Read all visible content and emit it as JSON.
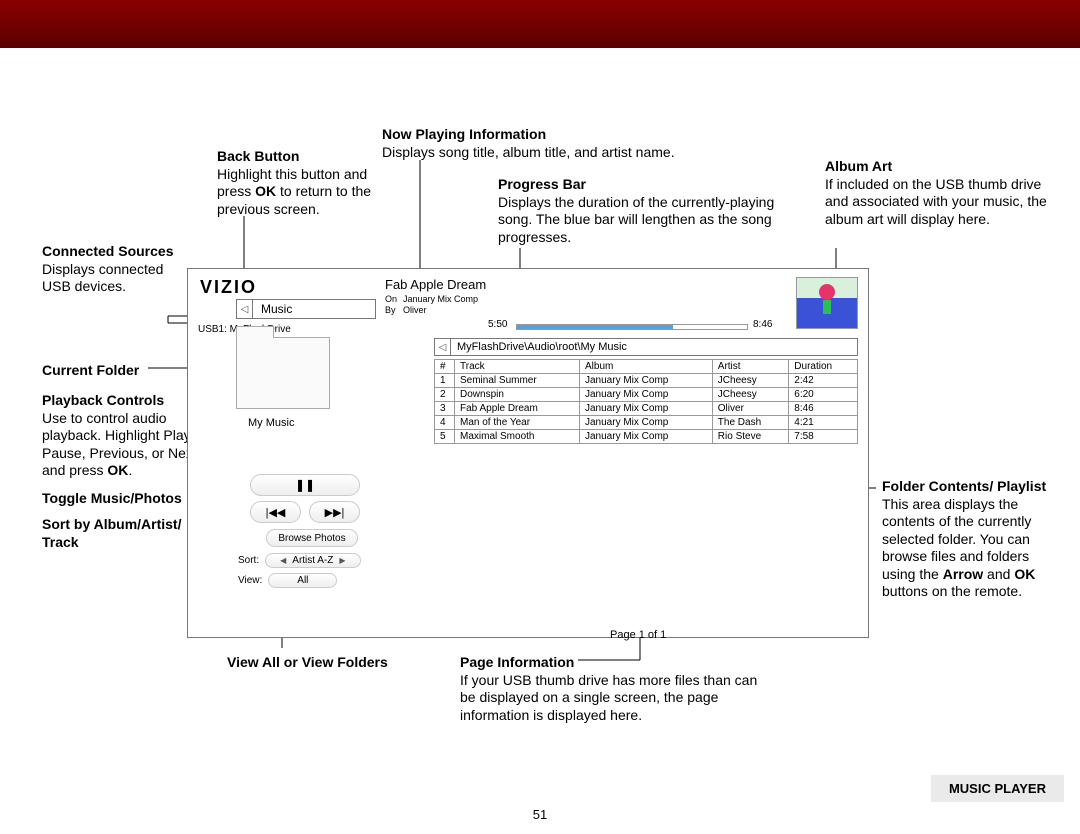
{
  "page_number": "51",
  "footer_label": "MUSIC PLAYER",
  "annotations": {
    "back_button": {
      "title": "Back Button",
      "body": "Highlight this button and press OK to return to the previous screen."
    },
    "now_playing": {
      "title": "Now Playing Information",
      "body": "Displays song title, album title, and artist name."
    },
    "progress_bar": {
      "title": "Progress Bar",
      "body": "Displays the duration of the currently-playing song. The blue bar will lengthen as the song progresses."
    },
    "album_art": {
      "title": "Album Art",
      "body": "If included on the USB thumb drive and associated with your music, the album art will display here."
    },
    "connected_sources": {
      "title": "Connected Sources",
      "body": "Displays connected USB devices."
    },
    "current_folder": {
      "title": "Current Folder"
    },
    "playback_controls": {
      "title": "Playback Controls",
      "body": "Use to control audio playback. Highlight Play/ Pause, Previous, or Next and press OK."
    },
    "toggle": {
      "title": "Toggle Music/Photos"
    },
    "sort": {
      "title": "Sort by Album/Artist/ Track"
    },
    "view": {
      "title": "View All or View Folders"
    },
    "page_info": {
      "title": "Page Information",
      "body": "If your USB thumb drive has more files than can be displayed on a single screen, the page information is displayed here."
    },
    "folder_contents": {
      "title": "Folder Contents/ Playlist",
      "body_pre": "This area displays the contents of the currently selected folder. You can browse files and folders using the ",
      "body_bold": "Arrow",
      "body_mid": " and ",
      "body_bold2": "OK",
      "body_post": " buttons on the remote."
    }
  },
  "player": {
    "logo": "VIZIO",
    "music_label": "Music",
    "usb_source": "USB1: MyFlashDrive",
    "folder_label": "My Music",
    "browse_photos": "Browse Photos",
    "sort_label": "Sort:",
    "sort_value": "Artist A-Z",
    "view_label": "View:",
    "view_value": "All",
    "now_playing": {
      "title": "Fab Apple Dream",
      "on_label": "On",
      "on_value": "January Mix Comp",
      "by_label": "By",
      "by_value": "Oliver"
    },
    "time_elapsed": "5:50",
    "time_total": "8:46",
    "path": "MyFlashDrive\\Audio\\root\\My Music",
    "page_info": "Page 1 of 1",
    "columns": {
      "num": "#",
      "track": "Track",
      "album": "Album",
      "artist": "Artist",
      "duration": "Duration"
    },
    "tracks": [
      {
        "num": "1",
        "track": "Seminal Summer",
        "album": "January Mix Comp",
        "artist": "JCheesy",
        "duration": "2:42"
      },
      {
        "num": "2",
        "track": "Downspin",
        "album": "January Mix Comp",
        "artist": "JCheesy",
        "duration": "6:20"
      },
      {
        "num": "3",
        "track": "Fab Apple Dream",
        "album": "January Mix Comp",
        "artist": "Oliver",
        "duration": "8:46"
      },
      {
        "num": "4",
        "track": "Man of the Year",
        "album": "January Mix Comp",
        "artist": "The Dash",
        "duration": "4:21"
      },
      {
        "num": "5",
        "track": "Maximal Smooth",
        "album": "January Mix Comp",
        "artist": "Rio Steve",
        "duration": "7:58"
      }
    ]
  }
}
